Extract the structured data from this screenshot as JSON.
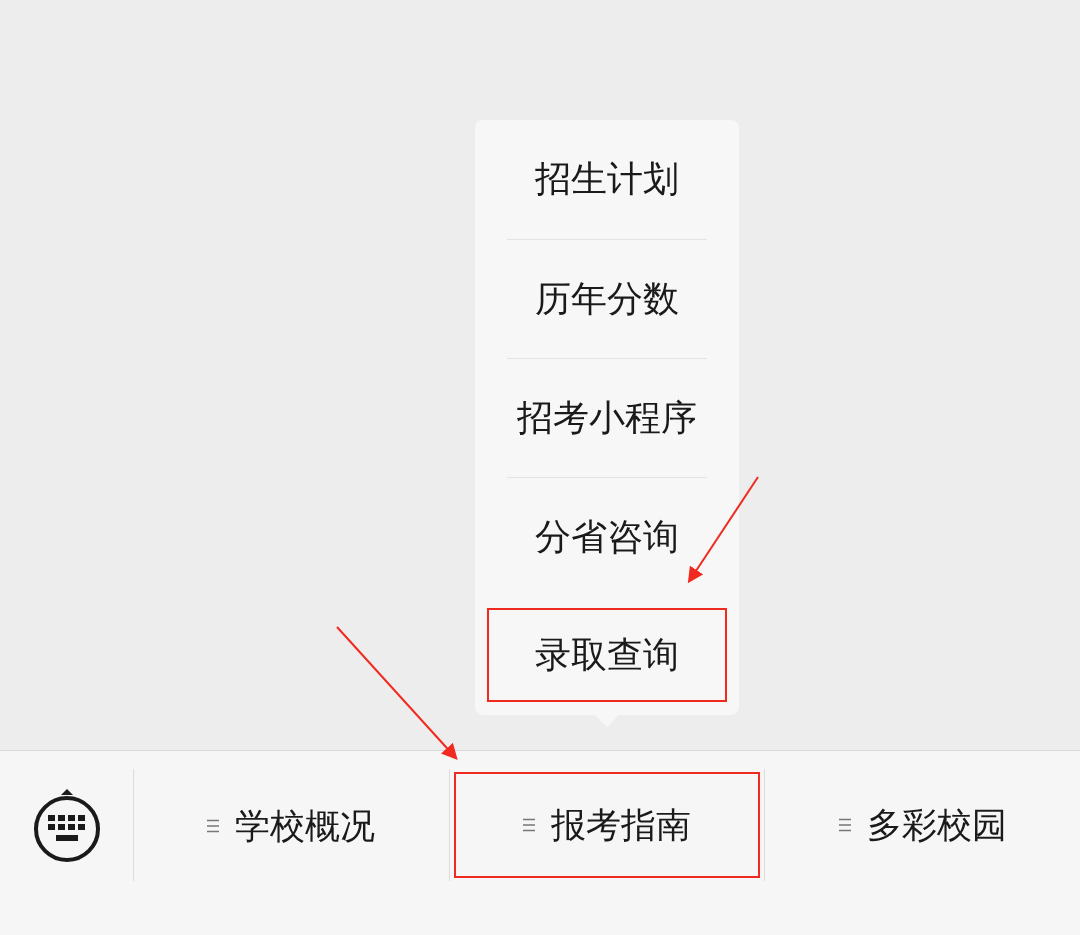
{
  "tabs": [
    {
      "label": "学校概况",
      "highlighted": false
    },
    {
      "label": "报考指南",
      "highlighted": true,
      "submenu": [
        {
          "label": "招生计划",
          "highlighted": false
        },
        {
          "label": "历年分数",
          "highlighted": false
        },
        {
          "label": "招考小程序",
          "highlighted": false
        },
        {
          "label": "分省咨询",
          "highlighted": false
        },
        {
          "label": "录取查询",
          "highlighted": true
        }
      ]
    },
    {
      "label": "多彩校园",
      "highlighted": false
    }
  ]
}
